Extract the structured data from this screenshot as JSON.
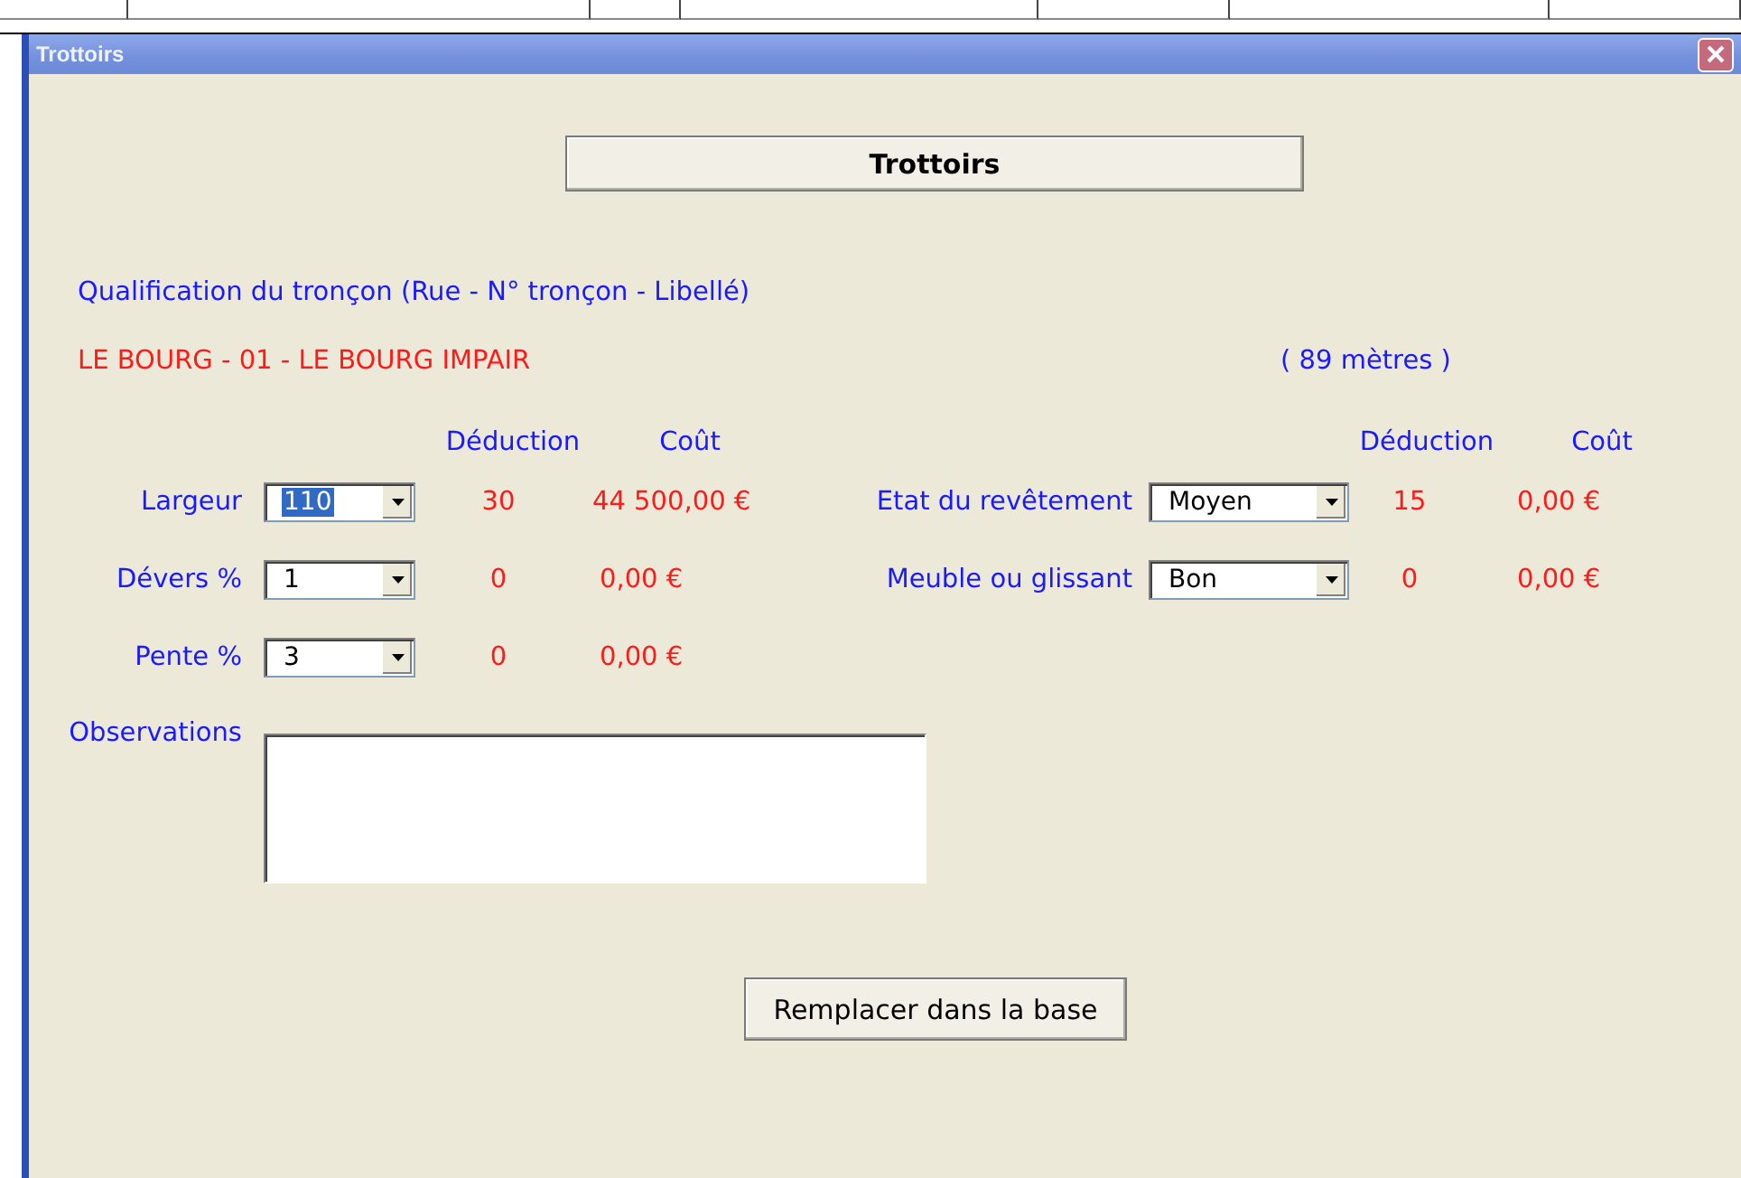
{
  "window": {
    "title": "Trottoirs"
  },
  "header_button": "Trottoirs",
  "section_label": "Qualification du tronçon (Rue - N° tronçon - Libellé)",
  "troncon": "LE BOURG - 01 - LE BOURG IMPAIR",
  "length": "( 89 mètres )",
  "left_headers": [
    "Déduction",
    "Coût"
  ],
  "right_headers": [
    "Déduction",
    "Coût"
  ],
  "left_fields": [
    {
      "label": "Largeur",
      "value": "110",
      "highlighted": true,
      "deduction": "30",
      "cost": "44 500,00 €"
    },
    {
      "label": "Dévers  %",
      "value": "1",
      "highlighted": false,
      "deduction": "0",
      "cost": "0,00 €"
    },
    {
      "label": "Pente %",
      "value": "3",
      "highlighted": false,
      "deduction": "0",
      "cost": "0,00 €"
    }
  ],
  "right_fields": [
    {
      "label": "Etat du revêtement",
      "value": "Moyen",
      "highlighted": false,
      "deduction": "15",
      "cost": "0,00 €"
    },
    {
      "label": "Meuble ou glissant",
      "value": "Bon",
      "highlighted": false,
      "deduction": "0",
      "cost": "0,00 €"
    }
  ],
  "observations": {
    "label": "Observations"
  },
  "submit_button": "Remplacer dans la base"
}
